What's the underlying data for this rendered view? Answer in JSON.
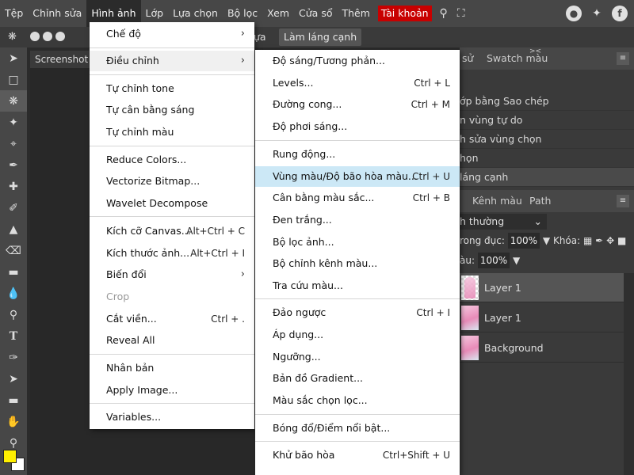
{
  "menubar": {
    "items": [
      "Tệp",
      "Chỉnh sửa",
      "Hình ảnh",
      "Lớp",
      "Lựa chọn",
      "Bộ lọc",
      "Xem",
      "Cửa sổ",
      "Thêm"
    ],
    "account": "Tài khoản"
  },
  "optbar": {
    "label_partial": "ựa",
    "smooth_button": "Làm láng cạnh"
  },
  "doc": {
    "tab": "Screenshot"
  },
  "panels": {
    "top_tab_partial": "sử",
    "swatch_tab": "Swatch màu",
    "collapse": "><",
    "history": [
      "ớp bằng Sao chép",
      "n vùng tự do",
      "h sửa vùng chọn",
      "họn",
      "láng cạnh"
    ],
    "layers_tabs": [
      "Kênh màu",
      "Path"
    ],
    "blend_mode": "h thường",
    "opacity_label": "rong đục:",
    "opacity_value": "100%",
    "lock_label": "Khóa:",
    "fill_label": "àu:",
    "fill_value": "100%",
    "layers": [
      "Layer 1",
      "Layer 1",
      "Background"
    ]
  },
  "menu_image": {
    "items": [
      {
        "label": "Chế độ",
        "arrow": "›"
      },
      {
        "label": "Điều chỉnh",
        "arrow": "›"
      },
      {
        "label": "Tự chỉnh tone"
      },
      {
        "label": "Tự cân bằng sáng"
      },
      {
        "label": "Tự chỉnh màu"
      },
      {
        "label": "Reduce Colors..."
      },
      {
        "label": "Vectorize Bitmap..."
      },
      {
        "label": "Wavelet Decompose"
      },
      {
        "label": "Kích cỡ Canvas...",
        "shortcut": "Alt+Ctrl + C"
      },
      {
        "label": "Kích thước ảnh...",
        "shortcut": "Alt+Ctrl + I"
      },
      {
        "label": "Biến đổi",
        "arrow": "›"
      },
      {
        "label": "Crop"
      },
      {
        "label": "Cắt viền...",
        "shortcut": "Ctrl + ."
      },
      {
        "label": "Reveal All"
      },
      {
        "label": "Nhân bản"
      },
      {
        "label": "Apply Image..."
      },
      {
        "label": "Variables..."
      }
    ]
  },
  "menu_adjust": {
    "items": [
      {
        "label": "Độ sáng/Tương phản..."
      },
      {
        "label": "Levels...",
        "shortcut": "Ctrl + L"
      },
      {
        "label": "Đường cong...",
        "shortcut": "Ctrl + M"
      },
      {
        "label": "Độ phơi sáng..."
      },
      {
        "label": "Rung động..."
      },
      {
        "label": "Vùng màu/Độ bão hòa màu...",
        "shortcut": "Ctrl + U"
      },
      {
        "label": "Cân bằng màu sắc...",
        "shortcut": "Ctrl + B"
      },
      {
        "label": "Đen trắng..."
      },
      {
        "label": "Bộ lọc ảnh..."
      },
      {
        "label": "Bộ chỉnh kênh màu..."
      },
      {
        "label": "Tra cứu màu..."
      },
      {
        "label": "Đảo ngược",
        "shortcut": "Ctrl + I"
      },
      {
        "label": "Áp dụng..."
      },
      {
        "label": "Ngưỡng..."
      },
      {
        "label": "Bản đồ Gradient..."
      },
      {
        "label": "Màu sắc chọn lọc..."
      },
      {
        "label": "Bóng đổ/Điểm nổi bật..."
      },
      {
        "label": "Khử bão hòa",
        "shortcut": "Ctrl+Shift + U"
      }
    ]
  },
  "colors": {
    "foreground": "#ffef00",
    "background": "#ffffff",
    "highlight": "#cce8f6",
    "account": "#c80000"
  }
}
